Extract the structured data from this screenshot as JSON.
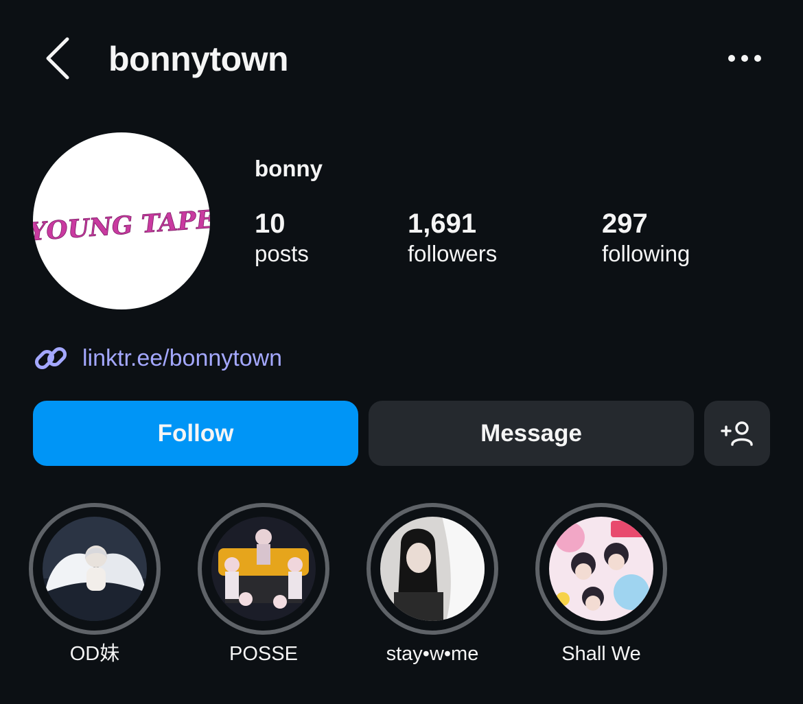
{
  "header": {
    "username": "bonnytown",
    "back_icon": "chevron-left-icon",
    "more_icon": "more-horizontal-icon"
  },
  "profile": {
    "display_name": "bonny",
    "avatar_text": "*YOUNG TAPE*",
    "avatar_color": "#c93aa0",
    "stats": [
      {
        "value": "10",
        "label": "posts"
      },
      {
        "value": "1,691",
        "label": "followers"
      },
      {
        "value": "297",
        "label": "following"
      }
    ],
    "link": {
      "icon": "link-icon",
      "text": "linktr.ee/bonnytown",
      "color": "#a4a8ff"
    }
  },
  "actions": {
    "follow_label": "Follow",
    "message_label": "Message",
    "add_user_icon": "add-person-icon",
    "follow_color": "#0095f6"
  },
  "highlights": [
    {
      "label": "OD妹"
    },
    {
      "label": "POSSE"
    },
    {
      "label": "stay•w•me"
    },
    {
      "label": "Shall We"
    }
  ]
}
